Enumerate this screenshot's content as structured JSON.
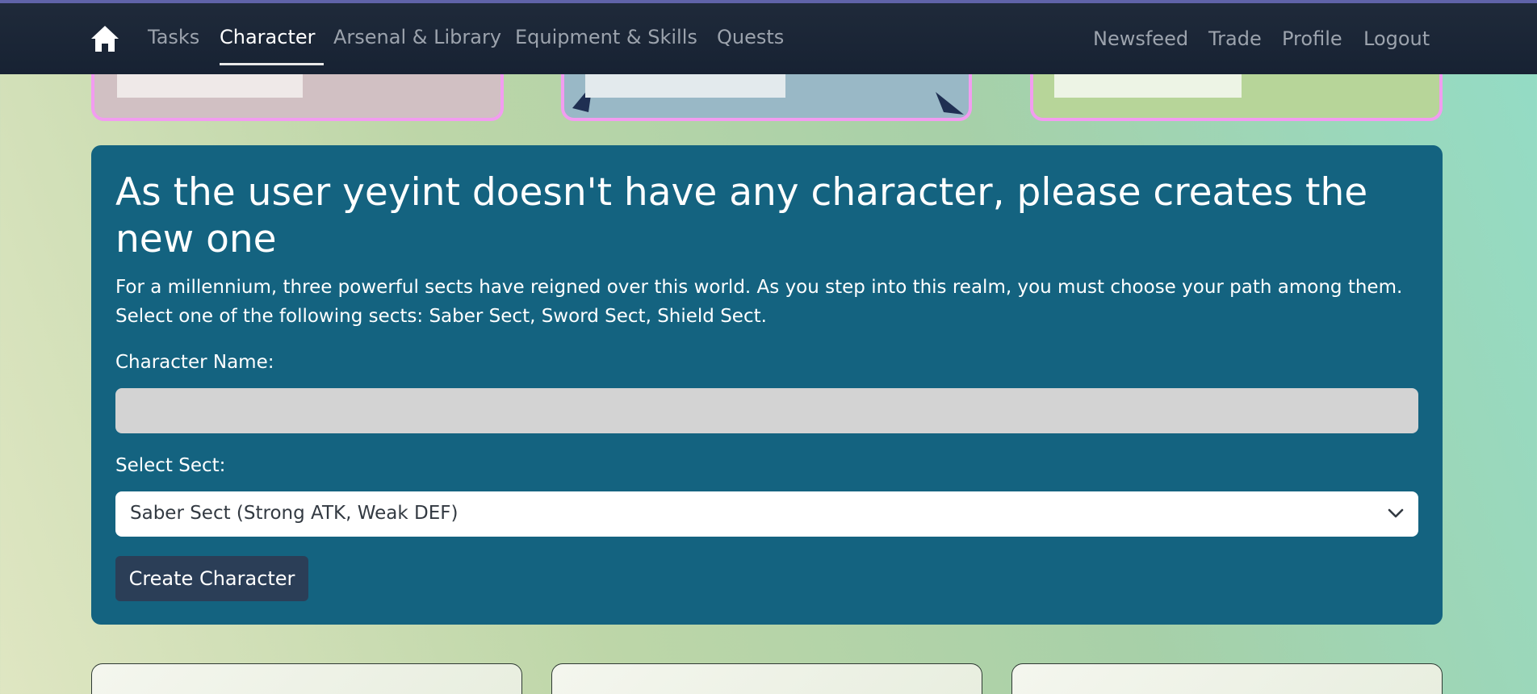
{
  "nav": {
    "home_icon": "home-icon",
    "left_links": [
      "Tasks",
      "Character",
      "Arsenal & Library",
      "Equipment & Skills",
      "Quests"
    ],
    "active": "Character",
    "right_links": [
      "Newsfeed",
      "Trade",
      "Profile",
      "Logout"
    ]
  },
  "panel": {
    "title": "As the user yeyint doesn't have any character, please creates the new one",
    "description": "For a millennium, three powerful sects have reigned over this world. As you step into this realm, you must choose your path among them. Select one of the following sects: Saber Sect, Sword Sect, Shield Sect.",
    "name_label": "Character Name:",
    "name_value": "",
    "sect_label": "Select Sect:",
    "sect_selected": "Saber Sect (Strong ATK, Weak DEF)",
    "create_button": "Create Character"
  },
  "colors": {
    "navbar": "#1c2636",
    "panel": "#146380",
    "button": "#2b3e57",
    "card_border": "#f29cf0"
  }
}
